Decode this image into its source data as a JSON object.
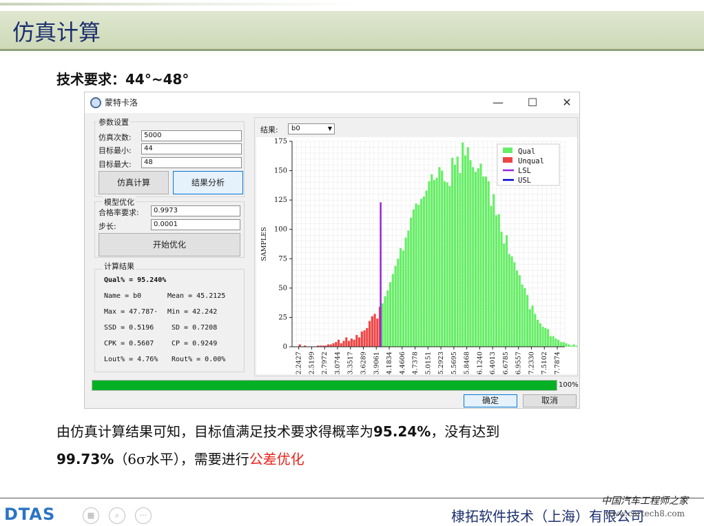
{
  "slide": {
    "title": "仿真计算",
    "requirement": "技术要求：44°~48°",
    "conclusion_line1_a": "由仿真计算结果可知，目标值满足技术要求得概率为",
    "conclusion_line1_b": "95.24%",
    "conclusion_line1_c": "，没有达到",
    "conclusion_line2_a": "99.73%",
    "conclusion_line2_b": "（6σ水平），需要进行",
    "conclusion_line2_c": "公差优化",
    "company": "棣拓软件技术（上海）有限公司",
    "watermark1": "中国汽车工程师之家",
    "watermark2": "www.cartech8.com",
    "logo": "DTAS"
  },
  "window": {
    "title": "蒙特卡洛",
    "minimize": "—",
    "maximize": "☐",
    "close": "✕"
  },
  "params": {
    "group_label": "参数设置",
    "sim_count_label": "仿真次数:",
    "sim_count_value": "5000",
    "target_min_label": "目标最小:",
    "target_min_value": "44",
    "target_max_label": "目标最大:",
    "target_max_value": "48",
    "simulate_button": "仿真计算",
    "analyze_button": "结果分析"
  },
  "optimize": {
    "group_label": "模型优化",
    "pass_rate_label": "合格率要求:",
    "pass_rate_value": "0.9973",
    "step_label": "步长:",
    "step_value": "0.0001",
    "start_button": "开始优化"
  },
  "results": {
    "group_label": "计算结果",
    "qual_line": "Qual% = 95.240%",
    "row1_left": "Name  = b0",
    "row1_right": "Mean  = 45.2125",
    "row2_left": "Max   = 47.787·",
    "row2_right": "Min   = 42.242",
    "row3_left": "SSD  = 0.5196",
    "row3_right": "SD    = 0.7208",
    "row4_left": "CPK  = 0.5607",
    "row4_right": "CP    = 0.9249",
    "row5_left": "Lout% = 4.76%",
    "row5_right": "Rout% = 0.00%"
  },
  "plot": {
    "result_label": "结果:",
    "result_selected": "b0"
  },
  "progress": {
    "value": 100,
    "label": "100%"
  },
  "dialog": {
    "ok": "确定",
    "cancel": "取消"
  },
  "colors": {
    "qual": "#66ee66",
    "unqual": "#ee4444",
    "lsl": "#9922dd",
    "usl": "#0000cc",
    "title_text": "#1c2f6e",
    "accent_red": "#e8221b",
    "progress": "#06b025"
  },
  "chart_data": {
    "type": "bar",
    "xlabel": "",
    "ylabel": "SAMPLES",
    "ylim": [
      0,
      175
    ],
    "yticks": [
      0,
      25,
      50,
      75,
      100,
      125,
      150,
      175
    ],
    "xticks": [
      "42.2427",
      "42.5199",
      "42.7972",
      "43.0744",
      "43.3517",
      "43.6289",
      "43.9061",
      "44.1834",
      "44.4606",
      "44.7378",
      "45.0151",
      "45.2923",
      "45.5695",
      "45.8468",
      "46.1240",
      "46.4013",
      "46.6785",
      "46.9557",
      "47.2330",
      "47.5102",
      "47.7874"
    ],
    "xrange": [
      42.1,
      47.95
    ],
    "grid": true,
    "legend": {
      "position": "top-right",
      "entries": [
        "Qual",
        "Unqual",
        "LSL",
        "USL"
      ]
    },
    "lsl": {
      "x": 44.0,
      "y": 123
    },
    "usl": {
      "x": 48.0
    },
    "bin_start": 42.2427,
    "bin_width": 0.05545,
    "bins": [
      2,
      0,
      1,
      0,
      0,
      0,
      0,
      1,
      1,
      1,
      1,
      2,
      2,
      3,
      4,
      6,
      3,
      5,
      8,
      5,
      7,
      6,
      10,
      8,
      13,
      14,
      16,
      22,
      26,
      28,
      24,
      34,
      37,
      43,
      48,
      55,
      62,
      69,
      75,
      84,
      82,
      93,
      99,
      110,
      117,
      122,
      121,
      126,
      128,
      133,
      141,
      147,
      142,
      144,
      153,
      150,
      141,
      140,
      137,
      161,
      155,
      162,
      148,
      174,
      163,
      170,
      159,
      153,
      149,
      152,
      156,
      145,
      145,
      141,
      120,
      130,
      112,
      113,
      98,
      88,
      95,
      79,
      77,
      72,
      65,
      61,
      53,
      50,
      44,
      32,
      35,
      28,
      23,
      20,
      17,
      16,
      15,
      9,
      9,
      7,
      6,
      4,
      4,
      3,
      2,
      1,
      2,
      1,
      1,
      2,
      1,
      1,
      0,
      0,
      1
    ]
  }
}
